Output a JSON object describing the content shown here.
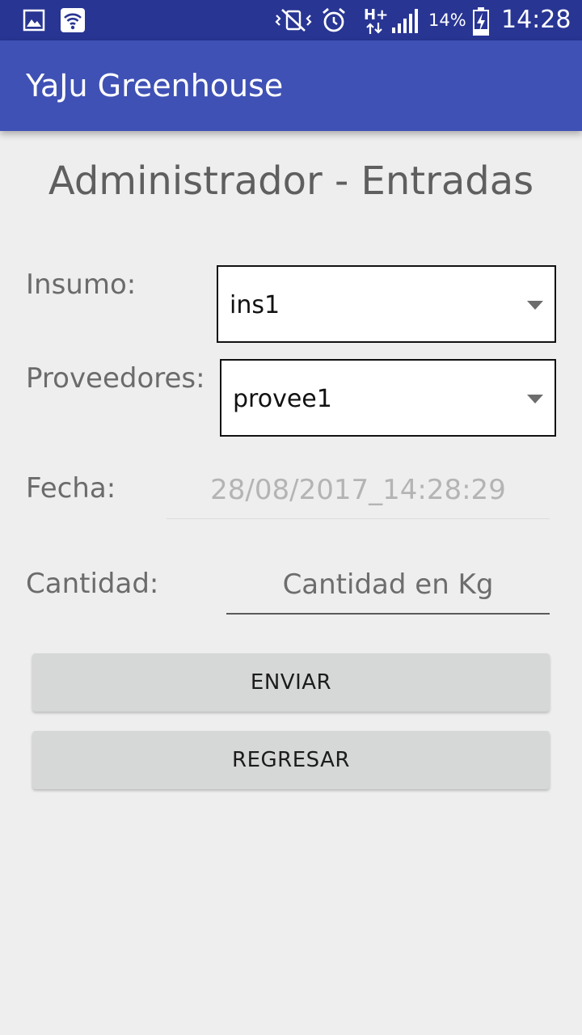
{
  "status_bar": {
    "battery_percent": "14%",
    "time": "14:28",
    "network_label": "H+",
    "icons": [
      "image-icon",
      "wifi-icon",
      "vibrate-icon",
      "alarm-icon",
      "data-arrows-icon",
      "signal-icon",
      "battery-charging-icon"
    ]
  },
  "app_bar": {
    "title": "YaJu Greenhouse"
  },
  "screen": {
    "title": "Administrador - Entradas"
  },
  "form": {
    "insumo": {
      "label": "Insumo:",
      "selected": "ins1",
      "icon": "dropdown-arrow-icon"
    },
    "proveedores": {
      "label": "Proveedores:",
      "selected": "provee1",
      "icon": "dropdown-arrow-icon"
    },
    "fecha": {
      "label": "Fecha:",
      "value": "28/08/2017_14:28:29"
    },
    "cantidad": {
      "label": "Cantidad:",
      "value": "",
      "placeholder": "Cantidad en Kg"
    }
  },
  "buttons": {
    "enviar": "ENVIAR",
    "regresar": "REGRESAR"
  },
  "colors": {
    "status_bar": "#283593",
    "app_bar": "#3f51b5",
    "background": "#eeeeee",
    "button": "#d6d7d7"
  }
}
